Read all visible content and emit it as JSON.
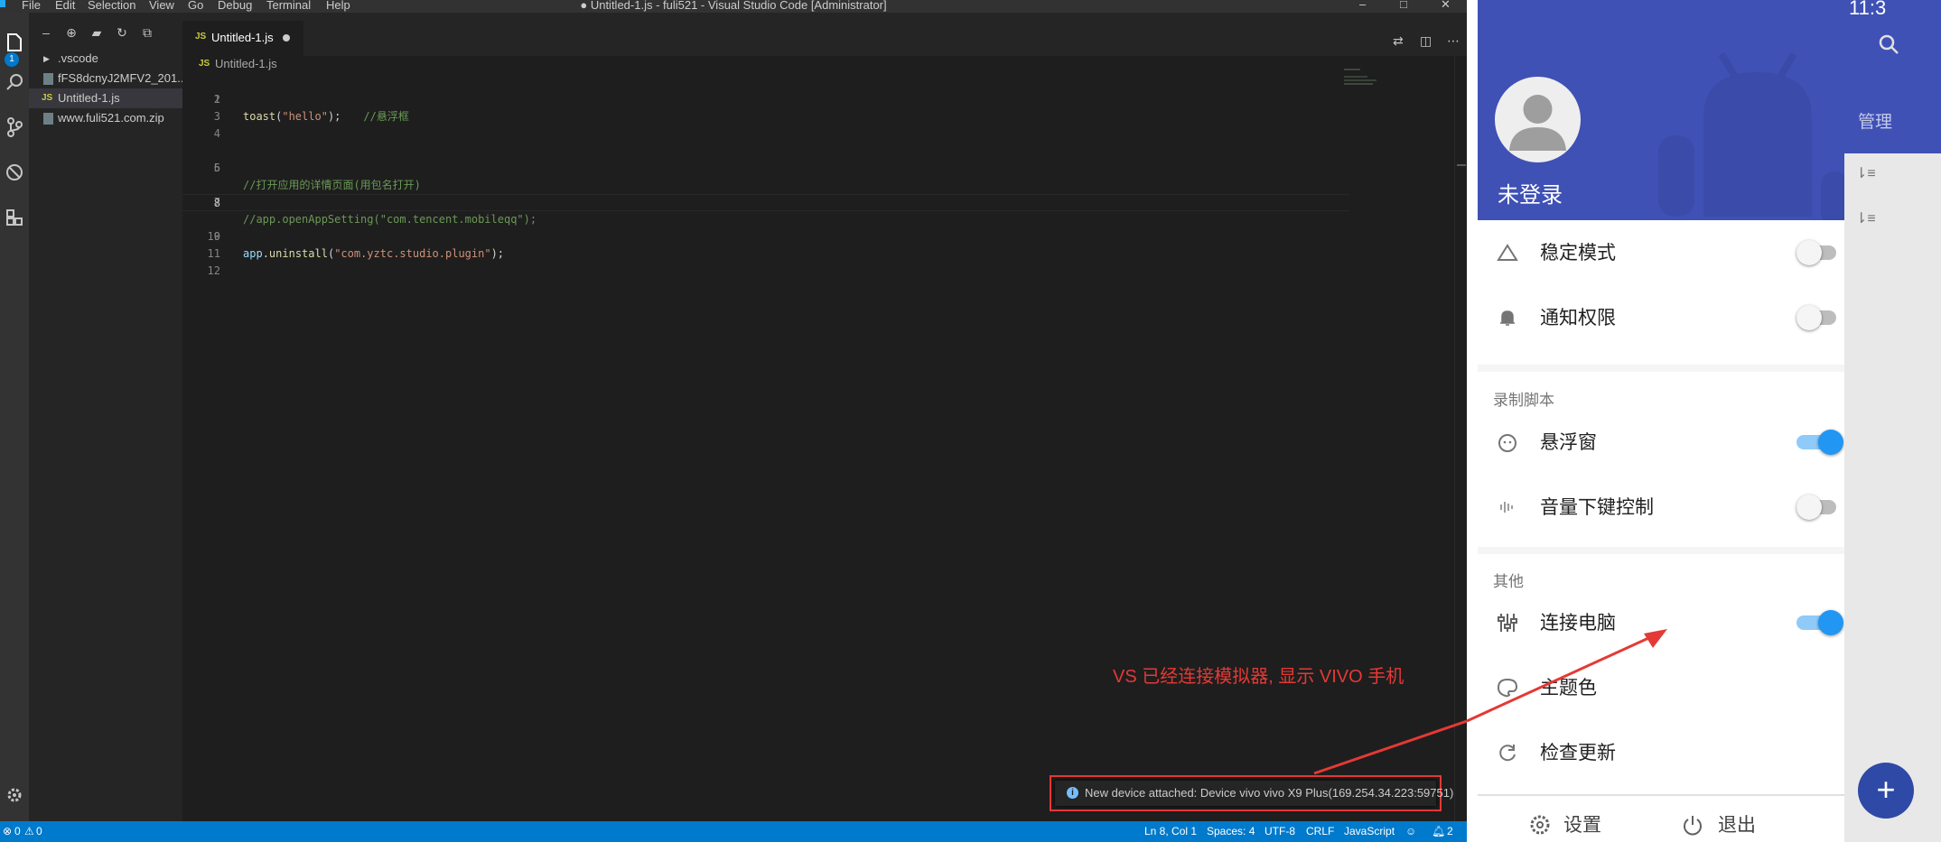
{
  "vscode": {
    "title": "● Untitled-1.js - fuli521 - Visual Studio Code [Administrator]",
    "menu": [
      "File",
      "Edit",
      "Selection",
      "View",
      "Go",
      "Debug",
      "Terminal",
      "Help"
    ],
    "activity_badge": "1",
    "explorer": {
      "items": [
        {
          "label": ".vscode",
          "type": "folder"
        },
        {
          "label": "fFS8dcnyJ2MFV2_201...",
          "type": "file"
        },
        {
          "label": "Untitled-1.js",
          "type": "js",
          "selected": true
        },
        {
          "label": "www.fuli521.com.zip",
          "type": "file"
        }
      ]
    },
    "tab": {
      "js_badge": "JS",
      "name": "Untitled-1.js"
    },
    "breadcrumb": {
      "js_badge": "JS",
      "name": "Untitled-1.js"
    },
    "code": {
      "line_numbers": [
        "1",
        "2",
        "3",
        "4",
        "5",
        "6",
        "7",
        "8",
        "9",
        "10",
        "11",
        "12"
      ],
      "line1": {
        "fn": "toast",
        "open": "(",
        "str": "\"hello\"",
        "close": ");",
        "comment": "//悬浮框"
      },
      "line5": {
        "comment": "//打开应用的详情页面(用包名打开)"
      },
      "line7": {
        "comment": "//app.openAppSetting(\"com.tencent.mobileqq\");"
      },
      "line9": {
        "obj": "app",
        "dot": ".",
        "fn": "uninstall",
        "open": "(",
        "str": "\"com.yztc.studio.plugin\"",
        "close": ");"
      }
    },
    "notification": {
      "icon": "i",
      "text": "New device attached: Device vivo vivo X9 Plus(169.254.34.223:59751)"
    },
    "annotation": "VS 已经连接模拟器, 显示 VIVO 手机",
    "statusbar": {
      "errors": "0",
      "warnings": "0",
      "position": "Ln 8, Col 1",
      "spaces": "Spaces: 4",
      "encoding": "UTF-8",
      "eol": "CRLF",
      "language": "JavaScript",
      "notifications": "2"
    }
  },
  "android": {
    "user_name": "未登录",
    "items": {
      "stable_mode": {
        "label": "稳定模式",
        "on": false
      },
      "notify_perm": {
        "label": "通知权限",
        "on": false
      },
      "floating": {
        "label": "悬浮窗",
        "on": true
      },
      "volume_key": {
        "label": "音量下键控制",
        "on": false
      },
      "connect_pc": {
        "label": "连接电脑",
        "on": true
      },
      "theme_color": {
        "label": "主题色"
      },
      "check_update": {
        "label": "检查更新"
      }
    },
    "sections": {
      "record": "录制脚本",
      "other": "其他"
    },
    "footer": {
      "settings": "设置",
      "exit": "退出"
    },
    "right": {
      "time": "11:3",
      "manage": "管理",
      "fab": "+"
    },
    "colors": {
      "header": "#3f51b5",
      "switch_on": "#2196f3",
      "annotation": "#e53935"
    }
  }
}
